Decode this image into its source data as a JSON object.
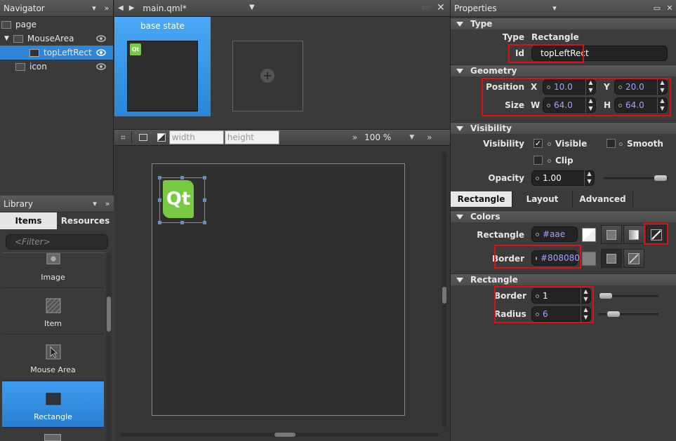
{
  "navigator": {
    "title": "Navigator",
    "items": [
      {
        "label": "page",
        "level": 0
      },
      {
        "label": "MouseArea",
        "level": 1
      },
      {
        "label": "topLeftRect",
        "level": 2,
        "selected": true
      },
      {
        "label": "icon",
        "level": 1
      }
    ]
  },
  "library": {
    "title": "Library",
    "tabs": [
      "Items",
      "Resources"
    ],
    "active_tab": "Items",
    "filter_placeholder": "<Filter>",
    "items": [
      "Image",
      "Item",
      "Mouse Area",
      "Rectangle"
    ],
    "selected": "Rectangle"
  },
  "editor": {
    "filename": "main.qml*",
    "state_label": "base state",
    "width_placeholder": "width",
    "height_placeholder": "height",
    "zoom": "100 %",
    "logo_text": "Qt"
  },
  "properties": {
    "title": "Properties",
    "type_section": "Type",
    "type_label": "Type",
    "type_value": "Rectangle",
    "id_label": "Id",
    "id_value": "topLeftRect",
    "geometry_section": "Geometry",
    "position_label": "Position",
    "size_label": "Size",
    "x_label": "X",
    "x_value": "10.0",
    "y_label": "Y",
    "y_value": "20.0",
    "w_label": "W",
    "w_value": "64.0",
    "h_label": "H",
    "h_value": "64.0",
    "visibility_section": "Visibility",
    "visibility_label": "Visibility",
    "visible_label": "Visible",
    "smooth_label": "Smooth",
    "clip_label": "Clip",
    "opacity_label": "Opacity",
    "opacity_value": "1.00",
    "tabs": [
      "Rectangle",
      "Layout",
      "Advanced"
    ],
    "colors_section": "Colors",
    "rect_color_label": "Rectangle",
    "rect_color_value": "#aae",
    "border_color_label": "Border",
    "border_color_value": "#808080",
    "rectangle_section": "Rectangle",
    "border_label": "Border",
    "border_value": "1",
    "radius_label": "Radius",
    "radius_value": "6"
  },
  "colors": {
    "selection": "#2f86d6",
    "highlight": "#dd1111",
    "qt_green": "#7ac943"
  }
}
